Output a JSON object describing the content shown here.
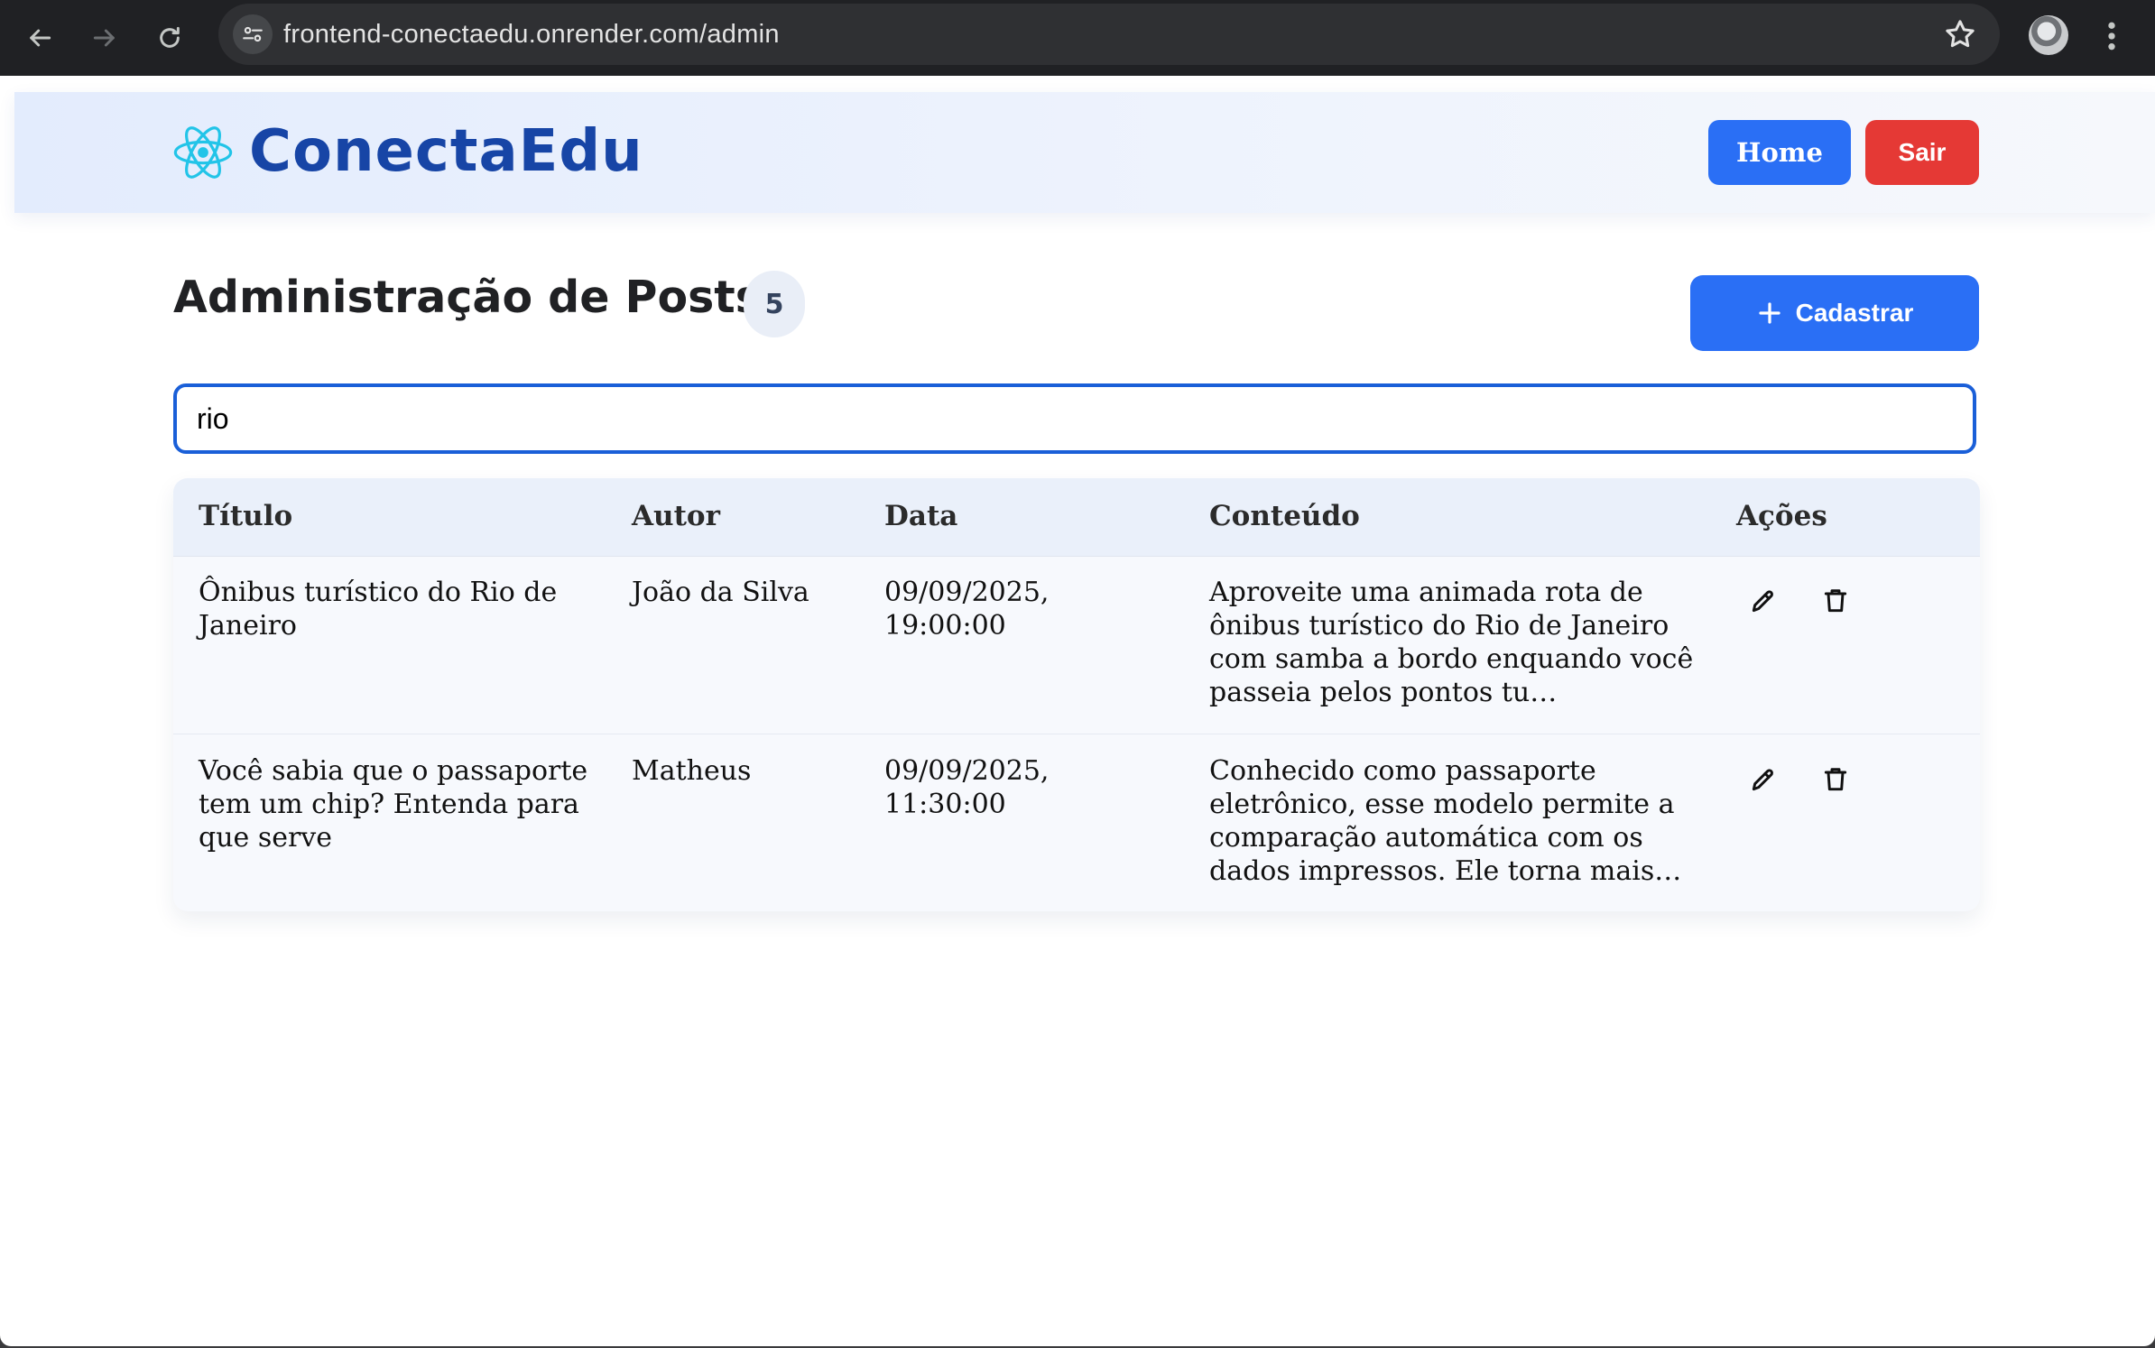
{
  "browser": {
    "url": "frontend-conectaedu.onrender.com/admin",
    "icons": {
      "back": "back-arrow-icon",
      "forward": "forward-arrow-icon",
      "reload": "reload-icon",
      "site_info": "tune-icon",
      "bookmark": "star-icon",
      "menu": "kebab-menu-icon"
    }
  },
  "header": {
    "brand": "ConectaEdu",
    "logo_icon": "atom-icon",
    "home_label": "Home",
    "logout_label": "Sair"
  },
  "page": {
    "title": "Administração de Posts",
    "post_count": "5",
    "add_label": "Cadastrar",
    "add_icon": "plus-icon"
  },
  "search": {
    "value": "rio",
    "placeholder": ""
  },
  "table": {
    "columns": [
      "Título",
      "Autor",
      "Data",
      "Conteúdo",
      "Ações"
    ],
    "rows": [
      {
        "title": "Ônibus turístico do Rio de Janeiro",
        "author": "João da Silva",
        "date": "09/09/2025, 19:00:00",
        "content": "Aproveite uma animada rota de ônibus turístico do Rio de Janeiro com samba a bordo enquando você passeia pelos pontos tu…"
      },
      {
        "title": "Você sabia que o passaporte tem um chip? Entenda para que serve",
        "author": "Matheus",
        "date": "09/09/2025, 11:30:00",
        "content": "Conhecido como passaporte eletrônico, esse modelo permite a comparação automática com os dados impressos. Ele torna mais…"
      }
    ],
    "action_icons": [
      "pencil-icon",
      "trash-icon"
    ]
  },
  "colors": {
    "primary": "#2a6ff5",
    "danger": "#e53935",
    "brand": "#1745a6",
    "logo_accent": "#22c4e8"
  }
}
